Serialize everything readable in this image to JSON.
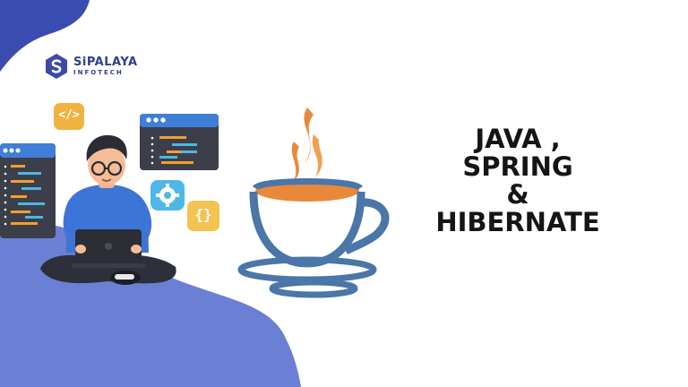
{
  "brand": {
    "name": "SiPALAYA",
    "subtitle": "INFOTECH"
  },
  "headline": {
    "line1": "JAVA ,",
    "line2": "SPRING",
    "line3": "&",
    "line4": "HIBERNATE"
  },
  "badges": {
    "code_tag": "</>",
    "braces": "{}"
  },
  "colors": {
    "brand_blue": "#3b4aa8",
    "wave_blue": "#6f83d6",
    "java_orange": "#e8893a",
    "java_blue": "#4a76a8"
  }
}
